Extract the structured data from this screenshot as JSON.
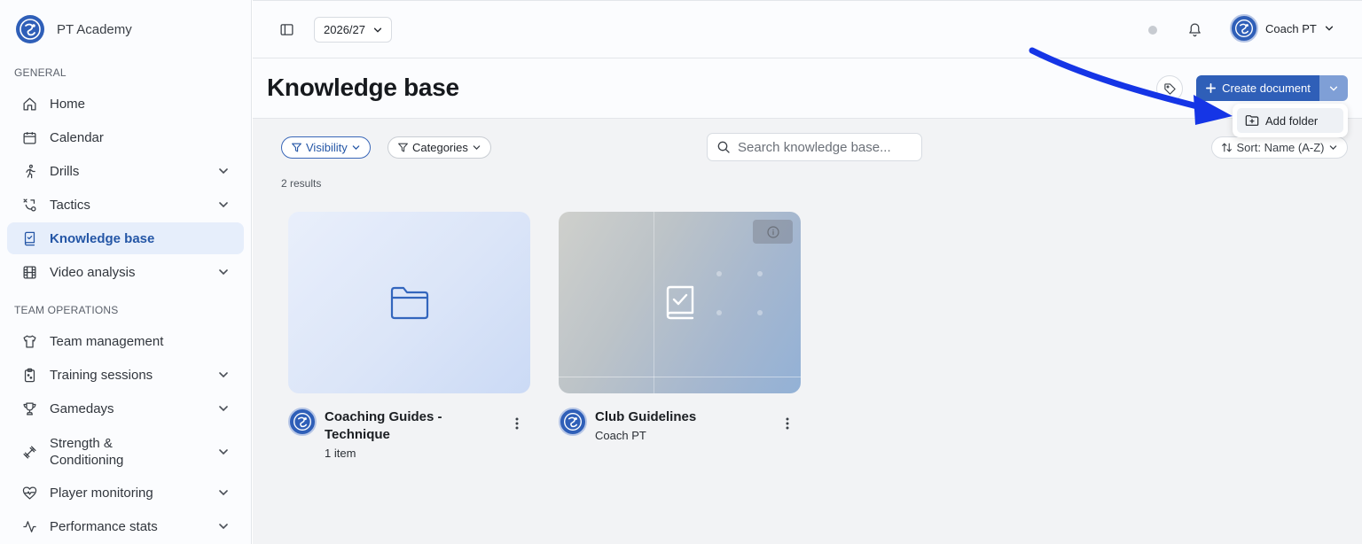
{
  "brand": {
    "name": "PT Academy"
  },
  "sidebar": {
    "sections": [
      {
        "label": "GENERAL"
      },
      {
        "label": "TEAM OPERATIONS"
      }
    ],
    "items": [
      {
        "label": "Home",
        "icon": "home-icon"
      },
      {
        "label": "Calendar",
        "icon": "calendar-icon"
      },
      {
        "label": "Drills",
        "icon": "running-icon"
      },
      {
        "label": "Tactics",
        "icon": "tactics-icon"
      },
      {
        "label": "Knowledge base",
        "icon": "book-check-icon",
        "active": true
      },
      {
        "label": "Video analysis",
        "icon": "film-icon"
      },
      {
        "label": "Team management",
        "icon": "shirt-icon"
      },
      {
        "label": "Training sessions",
        "icon": "clipboard-icon"
      },
      {
        "label": "Gamedays",
        "icon": "trophy-icon"
      },
      {
        "label": "Strength & Conditioning",
        "line1": "Strength &",
        "line2": "Conditioning",
        "icon": "dumbbell-icon"
      },
      {
        "label": "Player monitoring",
        "icon": "heart-pulse-icon"
      },
      {
        "label": "Performance stats",
        "icon": "activity-icon"
      }
    ]
  },
  "header": {
    "season": "2026/27",
    "user": "Coach PT"
  },
  "page": {
    "title": "Knowledge base",
    "create_label": "Create document",
    "dropdown_item": "Add folder"
  },
  "filters": {
    "visibility": "Visibility",
    "categories": "Categories",
    "search_placeholder": "Search knowledge base...",
    "sort": "Sort: Name (A-Z)",
    "results": "2 results"
  },
  "cards": [
    {
      "title": "Coaching Guides - Technique",
      "title_line1": "Coaching Guides -",
      "title_line2": "Technique",
      "subtitle": "1 item",
      "type": "folder"
    },
    {
      "title": "Club Guidelines",
      "subtitle": "Coach PT",
      "type": "document"
    }
  ],
  "colors": {
    "accent": "#2f5fb8",
    "active_bg": "#e6eefb",
    "arrow": "#1535e6"
  }
}
